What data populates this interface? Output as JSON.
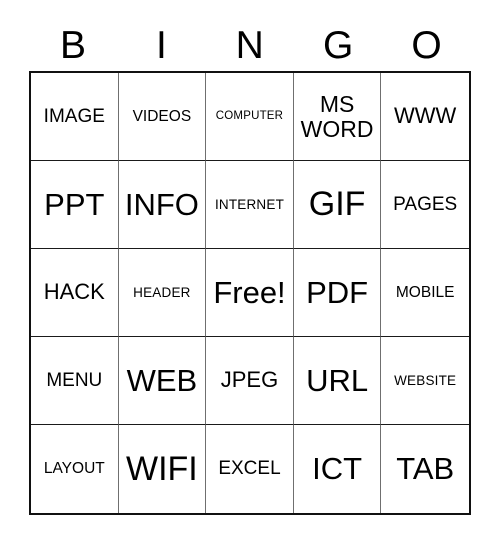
{
  "card": {
    "header_letters": [
      "B",
      "I",
      "N",
      "G",
      "O"
    ],
    "grid": {
      "rows": 5,
      "columns": 5,
      "free_space_label": "Free!",
      "free_space_position": {
        "row": 3,
        "column": 3
      },
      "cells": [
        [
          {
            "text": "IMAGE",
            "size": "m"
          },
          {
            "text": "VIDEOS",
            "size": "s"
          },
          {
            "text": "COMPUTER",
            "size": "xxs"
          },
          {
            "text": "MS\nWORD",
            "size": "two"
          },
          {
            "text": "WWW",
            "size": "l"
          }
        ],
        [
          {
            "text": "PPT",
            "size": "xxl"
          },
          {
            "text": "INFO",
            "size": "xxl"
          },
          {
            "text": "INTERNET",
            "size": "xs"
          },
          {
            "text": "GIF",
            "size": "3xl"
          },
          {
            "text": "PAGES",
            "size": "m"
          }
        ],
        [
          {
            "text": "HACK",
            "size": "l"
          },
          {
            "text": "HEADER",
            "size": "xs"
          },
          {
            "text": "Free!",
            "size": "xxl"
          },
          {
            "text": "PDF",
            "size": "xxl"
          },
          {
            "text": "MOBILE",
            "size": "s"
          }
        ],
        [
          {
            "text": "MENU",
            "size": "m"
          },
          {
            "text": "WEB",
            "size": "xxl"
          },
          {
            "text": "JPEG",
            "size": "l"
          },
          {
            "text": "URL",
            "size": "xxl"
          },
          {
            "text": "WEBSITE",
            "size": "xs"
          }
        ],
        [
          {
            "text": "LAYOUT",
            "size": "s"
          },
          {
            "text": "WIFI",
            "size": "3xl"
          },
          {
            "text": "EXCEL",
            "size": "m"
          },
          {
            "text": "ICT",
            "size": "xxl"
          },
          {
            "text": "TAB",
            "size": "xxl"
          }
        ]
      ]
    }
  },
  "colors": {
    "background": "#ffffff",
    "text": "#000000",
    "grid_border_outer": "#111111",
    "grid_line_vertical": "#6f6f6f",
    "grid_line_horizontal": "#1a1a1a"
  }
}
